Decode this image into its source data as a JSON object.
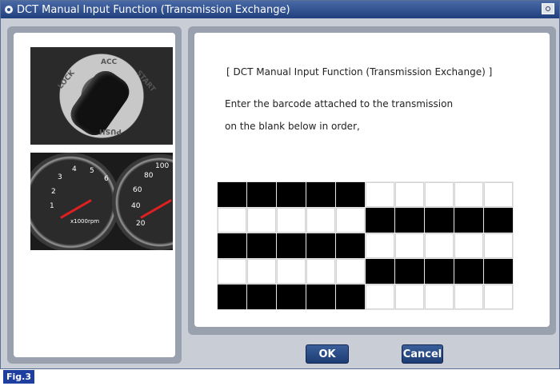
{
  "window": {
    "title": "DCT Manual Input Function (Transmission Exchange)",
    "title_icon": "circle-icon",
    "camera_icon": "camera-icon"
  },
  "images": {
    "ignition_key": {
      "labels": [
        "LOCK",
        "ACC",
        "START",
        "PUSH"
      ]
    },
    "instrument_cluster": {
      "tach_numbers": [
        "1",
        "2",
        "3",
        "4",
        "5",
        "6"
      ],
      "speed_numbers": [
        "20",
        "40",
        "60",
        "80",
        "100"
      ],
      "tach_unit": "x1000rpm"
    }
  },
  "main": {
    "heading": "[ DCT Manual Input Function (Transmission Exchange) ]",
    "instruction_line1": "Enter the barcode attached to the transmission",
    "instruction_line2": "on the blank below in order,"
  },
  "barcode_grid": {
    "rows": 5,
    "cols": 10,
    "filled_rows": [
      [
        1,
        1,
        1,
        1,
        1,
        0,
        0,
        0,
        0,
        0
      ],
      [
        0,
        0,
        0,
        0,
        0,
        1,
        1,
        1,
        1,
        1
      ],
      [
        1,
        1,
        1,
        1,
        1,
        0,
        0,
        0,
        0,
        0
      ],
      [
        0,
        0,
        0,
        0,
        0,
        1,
        1,
        1,
        1,
        1
      ],
      [
        1,
        1,
        1,
        1,
        1,
        0,
        0,
        0,
        0,
        0
      ]
    ]
  },
  "buttons": {
    "ok_label": "OK",
    "cancel_label": "Cancel"
  },
  "figure_label": "Fig.3",
  "colors": {
    "titlebar": "#1f3f7e",
    "panel": "#9aa1ae",
    "button": "#2a4f8a",
    "fig_badge": "#1f3fa0"
  }
}
